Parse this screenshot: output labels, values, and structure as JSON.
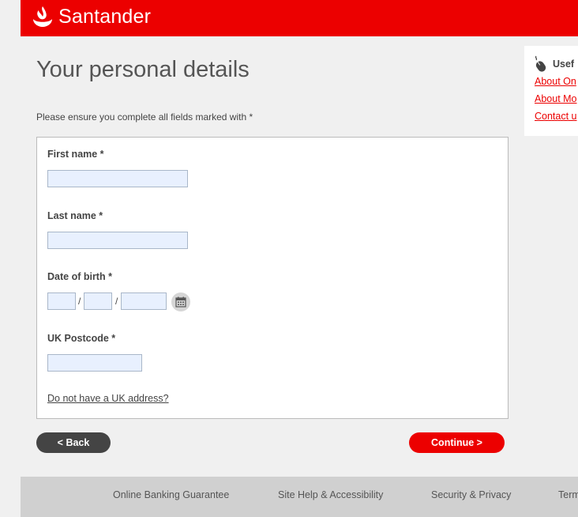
{
  "brand": {
    "name": "Santander",
    "color": "#ec0000"
  },
  "page": {
    "title": "Your personal details",
    "instructions": "Please ensure you complete all fields marked with *"
  },
  "form": {
    "first_name": {
      "label": "First name *",
      "value": ""
    },
    "last_name": {
      "label": "Last name *",
      "value": ""
    },
    "dob": {
      "label": "Date of birth *",
      "separator": "/",
      "day": "",
      "month": "",
      "year": "",
      "calendar_icon": "calendar-icon"
    },
    "postcode": {
      "label": "UK Postcode *",
      "value": ""
    },
    "no_uk_address_link": "Do not have a UK address?"
  },
  "buttons": {
    "back": "< Back",
    "continue": "Continue >"
  },
  "sidebar": {
    "heading": "Usef",
    "icon": "mouse-icon",
    "links": [
      "About On",
      "About Mo",
      "Contact u"
    ]
  },
  "footer": {
    "links": [
      "Online Banking Guarantee",
      "Site Help & Accessibility",
      "Security & Privacy",
      "Term"
    ]
  }
}
